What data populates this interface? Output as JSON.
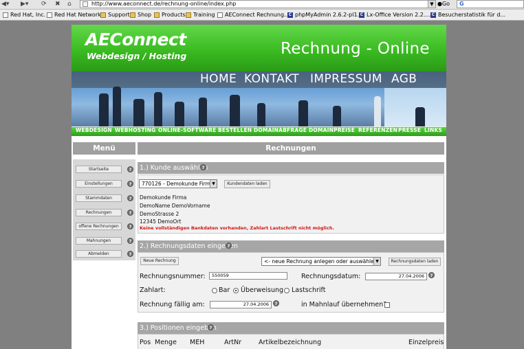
{
  "browser": {
    "url": "http://www.aeconnect.de/rechnung-online/index.php",
    "go_label": "Go",
    "bookmarks": [
      {
        "label": "Red Hat, Inc.",
        "icon": "page-icon"
      },
      {
        "label": "Red Hat Network",
        "icon": "page-icon"
      },
      {
        "label": "Support",
        "icon": "folder-icon"
      },
      {
        "label": "Shop",
        "icon": "folder-icon"
      },
      {
        "label": "Products",
        "icon": "folder-icon"
      },
      {
        "label": "Training",
        "icon": "folder-icon"
      },
      {
        "label": "AEConnect Rechnung...",
        "icon": "page-icon"
      },
      {
        "label": "phpMyAdmin 2.6.2-pl1...",
        "icon": "php-icon"
      },
      {
        "label": "Lx-Office Version 2.2....",
        "icon": "php-icon"
      },
      {
        "label": "Besucherstatistik für d...",
        "icon": "php-icon"
      }
    ]
  },
  "header": {
    "logo_main": "AEConnect",
    "logo_sub": "Webdesign / Hosting",
    "site_title": "Rechnung - Online",
    "top_nav": [
      "HOME",
      "KONTAKT",
      "IMPRESSUM",
      "AGB"
    ],
    "sub_nav": [
      "WEBDESIGN",
      "WEBHOSTING",
      "ONLINE-SOFTWARE",
      "BESTELLEN",
      "DOMAINABFRAGE",
      "DOMAINPREISE",
      "REFERENZEN",
      "PRESSE",
      "LINKS"
    ]
  },
  "menu": {
    "title": "Menü",
    "items": [
      "Startseite",
      "Einstellungen",
      "Stammdaten",
      "Rechnungen",
      "offene Rechnungen",
      "Mahnungen",
      "Abmelden"
    ],
    "help_glyph": "?"
  },
  "content": {
    "title": "Rechnungen",
    "section1": {
      "title": "1.) Kunde auswählen",
      "customer_select": "770126 - Demokunde Firma",
      "load_button": "Kundendaten laden",
      "address": [
        "Demokunde Firma",
        "DemoName DemoVorname",
        "DemoStrasse 2",
        "12345 DemoOrt"
      ],
      "warning": "Keine vollständigen Bankdaten vorhanden, Zahlart Lastschrift nicht möglich."
    },
    "section2": {
      "title": "2.) Rechnungsdaten eingeben",
      "new_button": "Neue Rechnung",
      "invoice_select": "<- neue Rechnung anlegen oder auswählen -v",
      "load_button": "Rechnungsdaten laden",
      "number_label": "Rechnungsnummer:",
      "number_value": "550059",
      "date_label": "Rechnungsdatum:",
      "date_value": "27.04.2006",
      "payment_label": "Zahlart:",
      "payment_options": [
        "Bar",
        "Überweisung",
        "Lastschrift"
      ],
      "payment_selected": "Überweisung",
      "due_label": "Rechnung fällig am:",
      "due_value": "27.04.2006",
      "dunning_label": "in Mahnlauf übernehmen?"
    },
    "section3": {
      "title": "3.) Positionen eingeben",
      "columns": [
        "Pos",
        "Menge",
        "MEH",
        "ArtNr",
        "Artikelbezeichnung",
        "Einzelpreis"
      ]
    }
  },
  "colors": {
    "green": "#3bbb22",
    "section_grey": "#a6a6a6",
    "warning_red": "#d01515"
  }
}
